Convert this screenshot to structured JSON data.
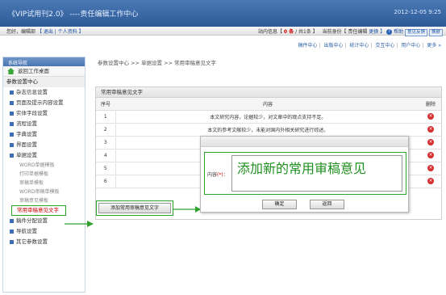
{
  "window": {
    "title": "《VIP试用刊2.0》 ----责任编辑工作中心",
    "date": "2012-12-05 9:25"
  },
  "infobar": {
    "greeting": "您好，编辑部",
    "logout": "【 退出",
    "profile": "| 个人资料 】",
    "messages_prefix": "站内信息【",
    "messages_unread": "0 条",
    "messages_total": "/ 共1条 】",
    "role_prefix": "当前身份【 责任编辑",
    "role_change": "更换 】",
    "help": "帮助",
    "skin_label": "意见反馈",
    "skin_btn": "换肤"
  },
  "topnav": [
    "稿件中心",
    "出版中心",
    "统计中心",
    "交互中心",
    "用户中心",
    "更多"
  ],
  "sidebar": {
    "header": "系统导航",
    "home": "返回工作桌面",
    "section": "参数设置中心",
    "groups": [
      "杂志信息设置",
      "页面及提示内容设置",
      "实体字段设置",
      "流程设置",
      "字典设置",
      "界面设置",
      "单据设置"
    ],
    "subs": [
      "WORD单据模板",
      "打印单据模板",
      "审稿单模板",
      "WORD审稿单模板",
      "审稿意见模板"
    ],
    "highlight": "常用审稿意见文字",
    "tail_groups": [
      "稿件分配设置",
      "导航设置",
      "其它参数设置"
    ]
  },
  "breadcrumb": "参数设置中心 >> 单据设置 >> 常用审稿意见文字",
  "panel": {
    "title": "常用审稿意见文字",
    "columns": {
      "index": "序号",
      "content": "内容",
      "delete": "删除"
    },
    "rows": [
      {
        "index": "1",
        "content": "本文研究内容，论据较少，对文章中的观点支持不足。"
      },
      {
        "index": "2",
        "content": "本文的参考文献较少，未能对国内外相关研究进行综述。"
      },
      {
        "index": "3",
        "content": ""
      },
      {
        "index": "4",
        "content": ""
      },
      {
        "index": "5",
        "content": ""
      },
      {
        "index": "6",
        "content": ""
      }
    ],
    "add_button": "添加常用审稿意见文字"
  },
  "dialog": {
    "label": "内容",
    "required": "(*)",
    "colon": "：",
    "value": "添加新的常用审稿意见",
    "ok": "确定",
    "cancel": "返回"
  },
  "colors": {
    "accent_green": "#2ea12e",
    "title_blue": "#3a68a6",
    "delete_red": "#d42e2e"
  }
}
